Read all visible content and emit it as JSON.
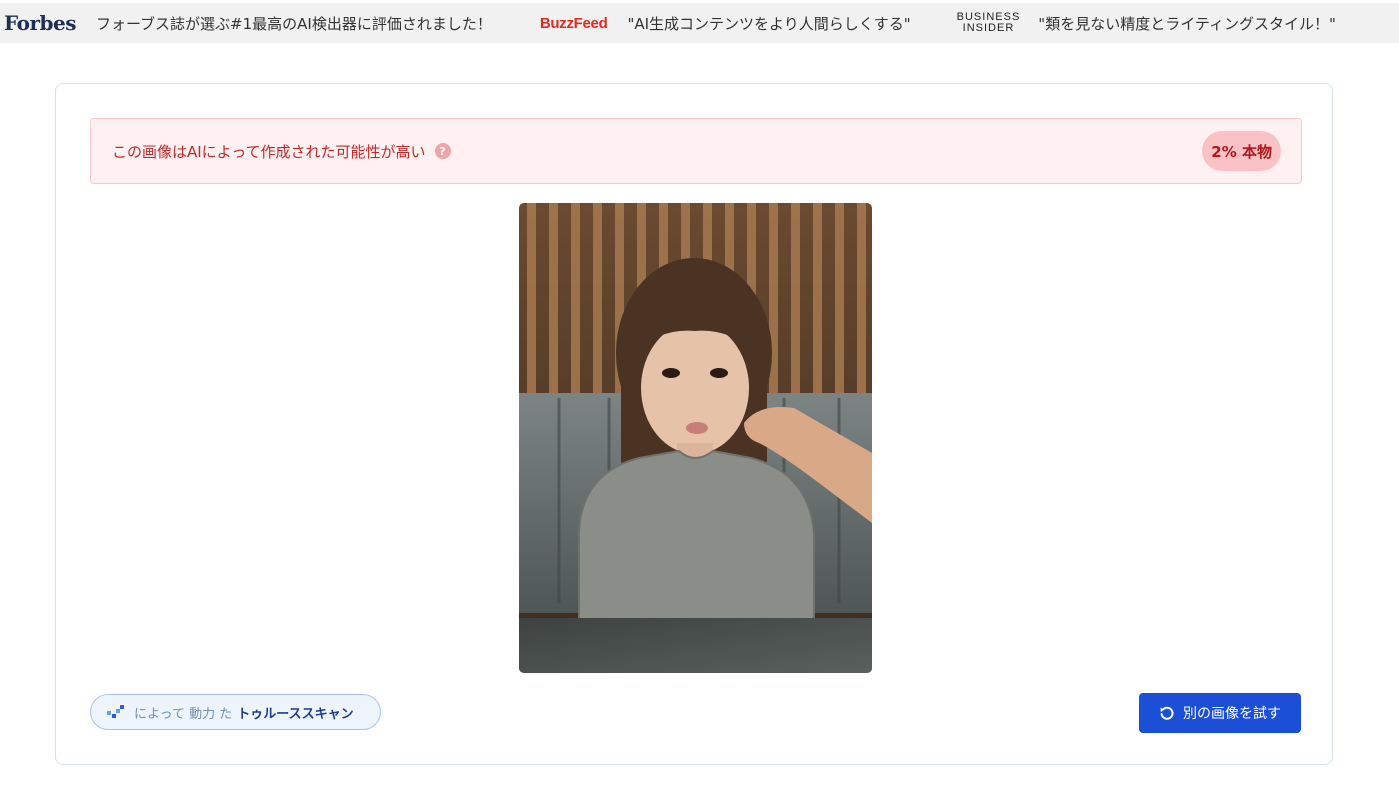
{
  "press": {
    "forbes_logo": "Forbes",
    "forbes_quote": "フォーブス誌が選ぶ#1最高のAI検出器に評価されました！",
    "buzzfeed_logo": "BuzzFeed",
    "buzzfeed_quote": "\"AI生成コンテンツをより人間らしくする\"",
    "bi_logo_line1": "BUSINESS",
    "bi_logo_line2": "INSIDER",
    "bi_quote": "\"類を見ない精度とライティングスタイル！\""
  },
  "result": {
    "message": "この画像はAIによって作成された可能性が高い",
    "help_icon": "?",
    "score_label": "2% 本物",
    "score_percent": 2,
    "status_color": "#c02a2a"
  },
  "image": {
    "icon": "uploaded-photo"
  },
  "footer": {
    "powered_prefix": "によって 動力 た",
    "powered_brand": "トゥルーススキャン",
    "retry_label": "別の画像を試す"
  },
  "colors": {
    "accent": "#1b4fd8",
    "alert_bg": "#fff0f1",
    "badge_bg": "#f9c3c6"
  }
}
